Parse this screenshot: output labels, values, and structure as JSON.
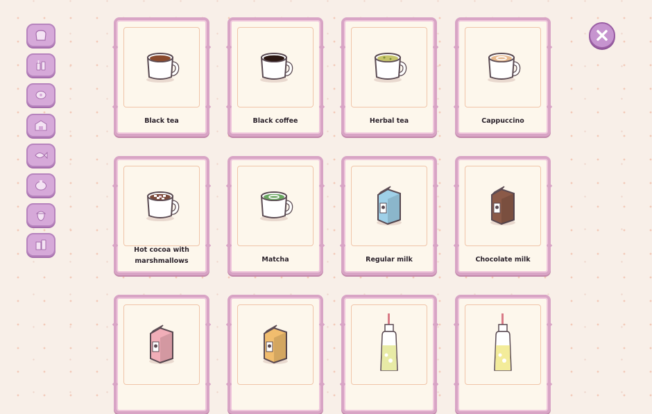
{
  "sidebar": {
    "buttons": [
      {
        "icon": "bread-icon"
      },
      {
        "icon": "bottles-icon"
      },
      {
        "icon": "meat-icon"
      },
      {
        "icon": "market-icon"
      },
      {
        "icon": "fish-icon"
      },
      {
        "icon": "pot-icon"
      },
      {
        "icon": "acorn-icon"
      },
      {
        "icon": "drinks-icon"
      }
    ]
  },
  "close_button": {
    "icon": "close-icon"
  },
  "cards": [
    {
      "label": "Black tea",
      "icon": "black-tea-icon",
      "kind": "cup",
      "color": "#8a4a2d"
    },
    {
      "label": "Black coffee",
      "icon": "black-coffee-icon",
      "kind": "cup",
      "color": "#2b1712"
    },
    {
      "label": "Herbal tea",
      "icon": "herbal-tea-icon",
      "kind": "cup",
      "color": "#c6c46a"
    },
    {
      "label": "Cappuccino",
      "icon": "cappuccino-icon",
      "kind": "cup",
      "color": "#e7b98e"
    },
    {
      "label": "Hot cocoa with marshmallows",
      "icon": "hot-cocoa-icon",
      "kind": "cup",
      "color": "#7b4a3a"
    },
    {
      "label": "Matcha",
      "icon": "matcha-icon",
      "kind": "cup",
      "color": "#6aa660"
    },
    {
      "label": "Regular milk",
      "icon": "regular-milk-icon",
      "kind": "carton",
      "color": "#9fd0e8"
    },
    {
      "label": "Chocolate milk",
      "icon": "chocolate-milk-icon",
      "kind": "carton",
      "color": "#8b5a48"
    },
    {
      "label": "",
      "icon": "strawberry-milk-icon",
      "kind": "carton",
      "color": "#f1aeb8"
    },
    {
      "label": "",
      "icon": "banana-milk-icon",
      "kind": "carton",
      "color": "#f1bd6e"
    },
    {
      "label": "",
      "icon": "soda-bottle-icon",
      "kind": "bottle",
      "color": "#e8eba6"
    },
    {
      "label": "",
      "icon": "lemonade-bottle-icon",
      "kind": "bottle",
      "color": "#f3ec9a"
    }
  ]
}
